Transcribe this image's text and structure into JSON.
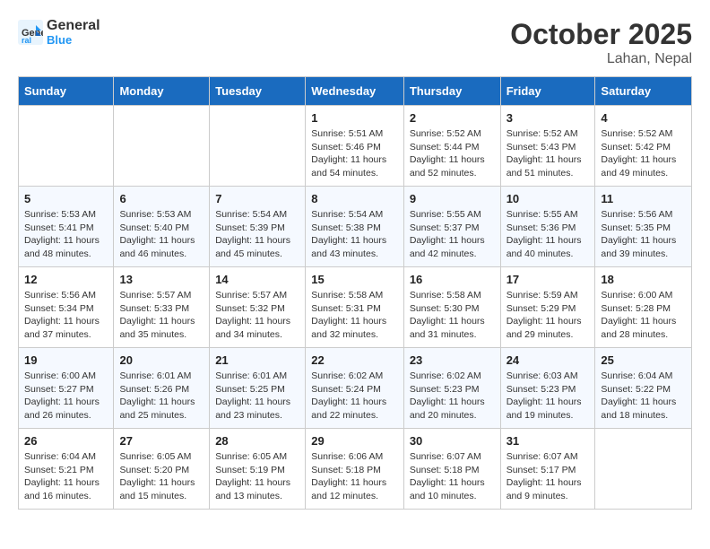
{
  "header": {
    "logo_line1": "General",
    "logo_line2": "Blue",
    "month": "October 2025",
    "location": "Lahan, Nepal"
  },
  "weekdays": [
    "Sunday",
    "Monday",
    "Tuesday",
    "Wednesday",
    "Thursday",
    "Friday",
    "Saturday"
  ],
  "weeks": [
    [
      {
        "day": "",
        "sunrise": "",
        "sunset": "",
        "daylight": ""
      },
      {
        "day": "",
        "sunrise": "",
        "sunset": "",
        "daylight": ""
      },
      {
        "day": "",
        "sunrise": "",
        "sunset": "",
        "daylight": ""
      },
      {
        "day": "1",
        "sunrise": "Sunrise: 5:51 AM",
        "sunset": "Sunset: 5:46 PM",
        "daylight": "Daylight: 11 hours and 54 minutes."
      },
      {
        "day": "2",
        "sunrise": "Sunrise: 5:52 AM",
        "sunset": "Sunset: 5:44 PM",
        "daylight": "Daylight: 11 hours and 52 minutes."
      },
      {
        "day": "3",
        "sunrise": "Sunrise: 5:52 AM",
        "sunset": "Sunset: 5:43 PM",
        "daylight": "Daylight: 11 hours and 51 minutes."
      },
      {
        "day": "4",
        "sunrise": "Sunrise: 5:52 AM",
        "sunset": "Sunset: 5:42 PM",
        "daylight": "Daylight: 11 hours and 49 minutes."
      }
    ],
    [
      {
        "day": "5",
        "sunrise": "Sunrise: 5:53 AM",
        "sunset": "Sunset: 5:41 PM",
        "daylight": "Daylight: 11 hours and 48 minutes."
      },
      {
        "day": "6",
        "sunrise": "Sunrise: 5:53 AM",
        "sunset": "Sunset: 5:40 PM",
        "daylight": "Daylight: 11 hours and 46 minutes."
      },
      {
        "day": "7",
        "sunrise": "Sunrise: 5:54 AM",
        "sunset": "Sunset: 5:39 PM",
        "daylight": "Daylight: 11 hours and 45 minutes."
      },
      {
        "day": "8",
        "sunrise": "Sunrise: 5:54 AM",
        "sunset": "Sunset: 5:38 PM",
        "daylight": "Daylight: 11 hours and 43 minutes."
      },
      {
        "day": "9",
        "sunrise": "Sunrise: 5:55 AM",
        "sunset": "Sunset: 5:37 PM",
        "daylight": "Daylight: 11 hours and 42 minutes."
      },
      {
        "day": "10",
        "sunrise": "Sunrise: 5:55 AM",
        "sunset": "Sunset: 5:36 PM",
        "daylight": "Daylight: 11 hours and 40 minutes."
      },
      {
        "day": "11",
        "sunrise": "Sunrise: 5:56 AM",
        "sunset": "Sunset: 5:35 PM",
        "daylight": "Daylight: 11 hours and 39 minutes."
      }
    ],
    [
      {
        "day": "12",
        "sunrise": "Sunrise: 5:56 AM",
        "sunset": "Sunset: 5:34 PM",
        "daylight": "Daylight: 11 hours and 37 minutes."
      },
      {
        "day": "13",
        "sunrise": "Sunrise: 5:57 AM",
        "sunset": "Sunset: 5:33 PM",
        "daylight": "Daylight: 11 hours and 35 minutes."
      },
      {
        "day": "14",
        "sunrise": "Sunrise: 5:57 AM",
        "sunset": "Sunset: 5:32 PM",
        "daylight": "Daylight: 11 hours and 34 minutes."
      },
      {
        "day": "15",
        "sunrise": "Sunrise: 5:58 AM",
        "sunset": "Sunset: 5:31 PM",
        "daylight": "Daylight: 11 hours and 32 minutes."
      },
      {
        "day": "16",
        "sunrise": "Sunrise: 5:58 AM",
        "sunset": "Sunset: 5:30 PM",
        "daylight": "Daylight: 11 hours and 31 minutes."
      },
      {
        "day": "17",
        "sunrise": "Sunrise: 5:59 AM",
        "sunset": "Sunset: 5:29 PM",
        "daylight": "Daylight: 11 hours and 29 minutes."
      },
      {
        "day": "18",
        "sunrise": "Sunrise: 6:00 AM",
        "sunset": "Sunset: 5:28 PM",
        "daylight": "Daylight: 11 hours and 28 minutes."
      }
    ],
    [
      {
        "day": "19",
        "sunrise": "Sunrise: 6:00 AM",
        "sunset": "Sunset: 5:27 PM",
        "daylight": "Daylight: 11 hours and 26 minutes."
      },
      {
        "day": "20",
        "sunrise": "Sunrise: 6:01 AM",
        "sunset": "Sunset: 5:26 PM",
        "daylight": "Daylight: 11 hours and 25 minutes."
      },
      {
        "day": "21",
        "sunrise": "Sunrise: 6:01 AM",
        "sunset": "Sunset: 5:25 PM",
        "daylight": "Daylight: 11 hours and 23 minutes."
      },
      {
        "day": "22",
        "sunrise": "Sunrise: 6:02 AM",
        "sunset": "Sunset: 5:24 PM",
        "daylight": "Daylight: 11 hours and 22 minutes."
      },
      {
        "day": "23",
        "sunrise": "Sunrise: 6:02 AM",
        "sunset": "Sunset: 5:23 PM",
        "daylight": "Daylight: 11 hours and 20 minutes."
      },
      {
        "day": "24",
        "sunrise": "Sunrise: 6:03 AM",
        "sunset": "Sunset: 5:23 PM",
        "daylight": "Daylight: 11 hours and 19 minutes."
      },
      {
        "day": "25",
        "sunrise": "Sunrise: 6:04 AM",
        "sunset": "Sunset: 5:22 PM",
        "daylight": "Daylight: 11 hours and 18 minutes."
      }
    ],
    [
      {
        "day": "26",
        "sunrise": "Sunrise: 6:04 AM",
        "sunset": "Sunset: 5:21 PM",
        "daylight": "Daylight: 11 hours and 16 minutes."
      },
      {
        "day": "27",
        "sunrise": "Sunrise: 6:05 AM",
        "sunset": "Sunset: 5:20 PM",
        "daylight": "Daylight: 11 hours and 15 minutes."
      },
      {
        "day": "28",
        "sunrise": "Sunrise: 6:05 AM",
        "sunset": "Sunset: 5:19 PM",
        "daylight": "Daylight: 11 hours and 13 minutes."
      },
      {
        "day": "29",
        "sunrise": "Sunrise: 6:06 AM",
        "sunset": "Sunset: 5:18 PM",
        "daylight": "Daylight: 11 hours and 12 minutes."
      },
      {
        "day": "30",
        "sunrise": "Sunrise: 6:07 AM",
        "sunset": "Sunset: 5:18 PM",
        "daylight": "Daylight: 11 hours and 10 minutes."
      },
      {
        "day": "31",
        "sunrise": "Sunrise: 6:07 AM",
        "sunset": "Sunset: 5:17 PM",
        "daylight": "Daylight: 11 hours and 9 minutes."
      },
      {
        "day": "",
        "sunrise": "",
        "sunset": "",
        "daylight": ""
      }
    ]
  ]
}
